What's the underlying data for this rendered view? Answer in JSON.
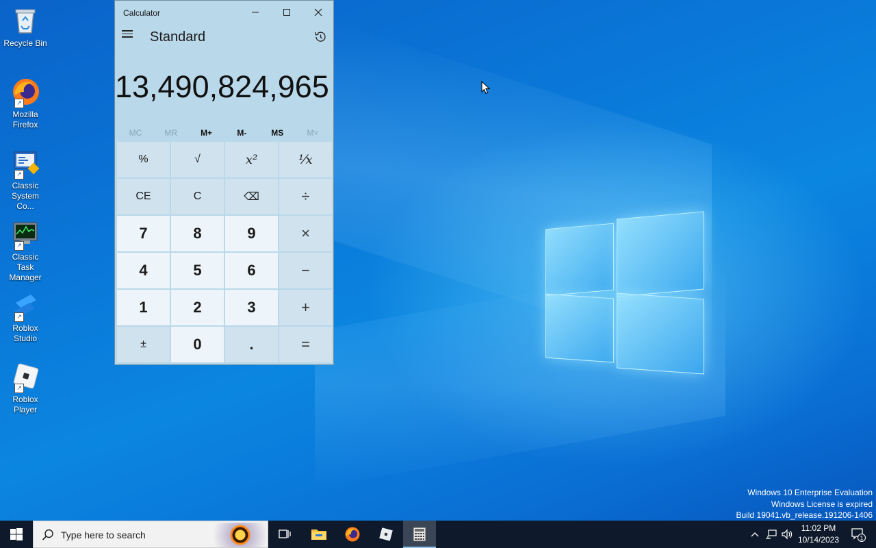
{
  "desktop": {
    "icons": [
      {
        "label": "Recycle Bin"
      },
      {
        "label": "Mozilla Firefox"
      },
      {
        "label": "Classic System Co..."
      },
      {
        "label": "Classic Task Manager"
      },
      {
        "label": "Roblox Studio"
      },
      {
        "label": "Roblox Player"
      }
    ],
    "watermark": {
      "line1": "Windows 10 Enterprise Evaluation",
      "line2": "Windows License is expired",
      "line3": "Build 19041.vb_release.191206-1406"
    }
  },
  "calculator": {
    "window_title": "Calculator",
    "mode": "Standard",
    "display_value": "13,490,824,965",
    "memory": {
      "mc": "MC",
      "mr": "MR",
      "mplus": "M+",
      "mminus": "M-",
      "ms": "MS",
      "mlist": "M˅"
    },
    "keys": {
      "percent": "%",
      "sqrt": "√",
      "square": "x²",
      "reciprocal": "¹⁄x",
      "ce": "CE",
      "c": "C",
      "backspace": "⌫",
      "divide": "÷",
      "seven": "7",
      "eight": "8",
      "nine": "9",
      "multiply": "×",
      "four": "4",
      "five": "5",
      "six": "6",
      "minus": "−",
      "one": "1",
      "two": "2",
      "three": "3",
      "plus": "+",
      "negate": "±",
      "zero": "0",
      "decimal": ".",
      "equals": "="
    }
  },
  "taskbar": {
    "search_placeholder": "Type here to search",
    "clock_time": "11:02 PM",
    "clock_date": "10/14/2023",
    "notification_count": "1"
  },
  "colors": {
    "desktop_blue": "#0a78d8",
    "calc_bg": "#b9d8ea",
    "taskbar_bg": "#0e1a2b"
  }
}
